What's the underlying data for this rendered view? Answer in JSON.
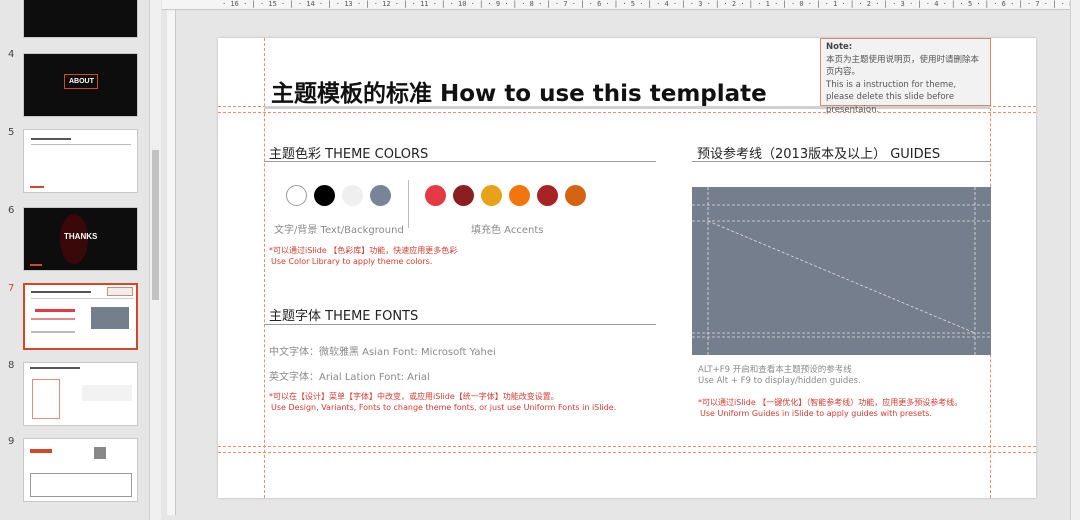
{
  "thumbnails": [
    {
      "number": "4",
      "caption": "ABOUT"
    },
    {
      "number": "5",
      "caption": ""
    },
    {
      "number": "6",
      "caption": "THANKS"
    },
    {
      "number": "7",
      "caption": ""
    },
    {
      "number": "8",
      "caption": ""
    },
    {
      "number": "9",
      "caption": ""
    }
  ],
  "ruler": {
    "horizontal": "· 16 · | · 15 · | · 14 · | · 13 · | · 12 · | · 11 · | · 10 · | · 9 · | · 8 · | · 7 · | · 6 · | · 5 · | · 4 · | · 3 · | · 2 · | · 1 · | · 0 · | · 1 · | · 2 · | · 3 · | · 4 · | · 5 · | · 6 · | · 7 · | · 8 · | · 9 · | · 10 · | · 11 · | · 12 · | · 13 · | · 14 · | · 15 · | · 16 ·"
  },
  "slide": {
    "title": "主题模板的标准 How to use this template",
    "note": {
      "heading": "Note:",
      "cn": "本页为主题使用说明页，使用时请删除本页内容。",
      "en": "This is a instruction for theme, please delete this slide before presentaion."
    },
    "colors": {
      "title": "主题色彩 THEME COLORS",
      "text_bg_label": "文字/背景 Text/Background",
      "accents_label": "填充色 Accents",
      "text_bg_swatches": [
        "#ffffff",
        "#000000",
        "#efefef",
        "#778597"
      ],
      "accent_swatches": [
        "#e53945",
        "#8b1e1e",
        "#e8a219",
        "#f2750e",
        "#a82323",
        "#d46412"
      ],
      "note_cn": "*可以通过iSlide 【色彩库】功能，快速应用更多色彩",
      "note_en": "Use Color Library to apply theme colors."
    },
    "fonts": {
      "title": "主题字体 THEME FONTS",
      "asian": "中文字体：微软雅黑  Asian Font: Microsoft Yahei",
      "latin": "英文字体：Arial  Lation Font: Arial",
      "note_cn": "*可以在【设计】菜单【字体】中改变，或应用iSlide【统一字体】功能改变设置。",
      "note_en": "Use Design, Variants, Fonts to change theme fonts, or just use Uniform Fonts in iSlide."
    },
    "guides": {
      "title": "预设参考线（2013版本及以上） GUIDES",
      "desc_cn": "ALT+F9 开启和查看本主题预设的参考线",
      "desc_en": "Use Alt + F9 to display/hidden guides.",
      "note_cn": "*可以通过iSlide 【一键优化】（智能参考线）功能，应用更多预设参考线。",
      "note_en": "Use Uniform Guides in iSlide to apply guides with presets."
    }
  }
}
